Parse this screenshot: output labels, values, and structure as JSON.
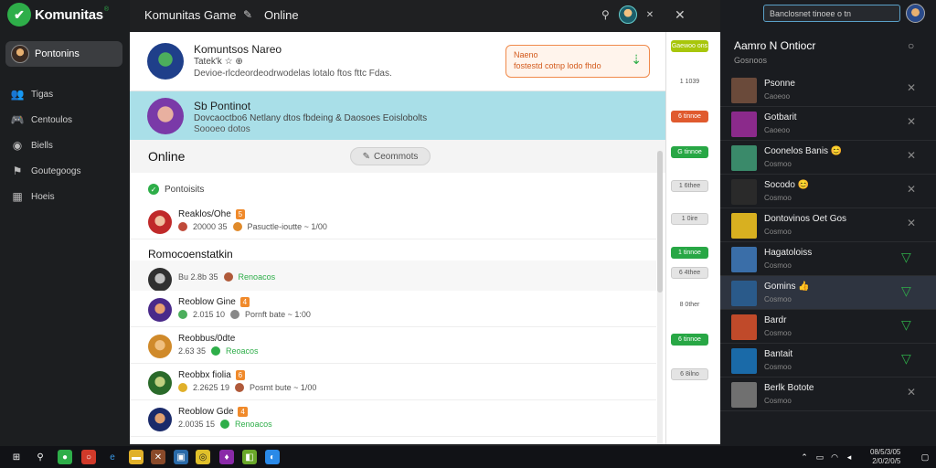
{
  "app": {
    "logo_text": "Komunitas",
    "logo_badge": "®",
    "title": "Komunitas Game",
    "status_title": "Online"
  },
  "sidebar": {
    "active": {
      "label": "Pontonins"
    },
    "items": [
      {
        "icon": "people-icon",
        "label": "Tigas"
      },
      {
        "icon": "gamepad-icon",
        "label": "Centoulos"
      },
      {
        "icon": "globe-icon",
        "label": "Biells"
      },
      {
        "icon": "community-icon",
        "label": "Goutegoogs"
      },
      {
        "icon": "calendar-icon",
        "label": "Hoeis"
      }
    ]
  },
  "main": {
    "profile_card": {
      "name": "Komuntsos Nareo",
      "sub": "Tatek'k ☆ ⊕",
      "desc": "Devioe-rlcdeordeodrwodelas lotalo ftos fttc Fdas."
    },
    "promo": {
      "line1": "Naeno",
      "line2": "fostestd cotnp lodo fhdo"
    },
    "highlight_card": {
      "name": "Sb Pontinot",
      "line1": "Dovcaoctbo6 Netlany dtos fbdeing & Daosoes Eoislobolts",
      "line2": "Soooeo dotos"
    },
    "online_section": {
      "title": "Online",
      "comments_button": "Ceommots"
    },
    "friends_label": "Pontoisits",
    "recommended_title": "Romocoenstatkin",
    "rows": [
      {
        "name": "Reaklos/Ohe",
        "badge": "5",
        "meta1": "20000 35",
        "meta2": "Pasuctle-ioutte ~ 1/00"
      },
      {
        "name": "",
        "badge": "",
        "meta1": "Bu 2.8b 35",
        "meta2": "Renoacos"
      },
      {
        "name": "Reoblow Gine",
        "badge": "4",
        "meta1": "2.015 10",
        "meta2": "Pornft bate ~ 1:00"
      },
      {
        "name": "Reobbus/0dte",
        "badge": "",
        "meta1": "2.63 35",
        "meta2": "Reoacos"
      },
      {
        "name": "Reobbx fiolia",
        "badge": "6",
        "meta1": "2.2625 19",
        "meta2": "Posmt bute ~ 1/00"
      },
      {
        "name": "Reoblow Gde",
        "badge": "4",
        "meta1": "2.0035 15",
        "meta2": "Renoacos"
      }
    ]
  },
  "midcol": {
    "pills": [
      {
        "style": "yg",
        "label": "Gaewoo ons"
      },
      {
        "style": "tx",
        "label": "1 1039"
      },
      {
        "style": "or",
        "label": "6 tinnoe"
      },
      {
        "style": "gr",
        "label": "G tinnoe"
      },
      {
        "style": "gy",
        "label": "1 6thee"
      },
      {
        "style": "gy",
        "label": "1 0ire"
      },
      {
        "style": "gr",
        "label": "1 tinnoe"
      },
      {
        "style": "gy",
        "label": "6 4thee"
      },
      {
        "style": "tx",
        "label": "8 0ther"
      },
      {
        "style": "gr",
        "label": "6 tinnoe"
      },
      {
        "style": "gy",
        "label": "6 8ilno"
      }
    ]
  },
  "right": {
    "search_value": "Banclosnet tinoee o tn",
    "title": "Aamro N Ontiocr",
    "subtitle": "Gosnoos",
    "friends": [
      {
        "name": "Psonne",
        "sub": "Caoeoo",
        "action": "close",
        "color": "#6a4a3a"
      },
      {
        "name": "Gotbarit",
        "sub": "Caoeoo",
        "action": "close",
        "color": "#8b2a8b"
      },
      {
        "name": "Coonelos Banis 😊",
        "sub": "Cosmoo",
        "action": "close",
        "color": "#3a8a6a"
      },
      {
        "name": "Socodo 😊",
        "sub": "Cosmoo",
        "action": "close",
        "color": "#2a2a2a"
      },
      {
        "name": "Dontovinos Oet Gos",
        "sub": "Cosmoo",
        "action": "close",
        "color": "#d8b020"
      },
      {
        "name": "Hagatoloiss",
        "sub": "Cosmoo",
        "action": "chevron",
        "color": "#3a6ea8"
      },
      {
        "name": "Gomins 👍",
        "sub": "Cosmoo",
        "action": "chevron",
        "color": "#2a5a8a"
      },
      {
        "name": "Bardr",
        "sub": "Cosmoo",
        "action": "chevron",
        "color": "#c04a2a"
      },
      {
        "name": "Bantait",
        "sub": "Cosmoo",
        "action": "chevron",
        "color": "#1a6aa8"
      },
      {
        "name": "Berlk Botote",
        "sub": "Cosmoo",
        "action": "close",
        "color": "#707070"
      }
    ]
  },
  "taskbar": {
    "time": "08/5/3/05",
    "date": "2/0/2/0/5"
  }
}
